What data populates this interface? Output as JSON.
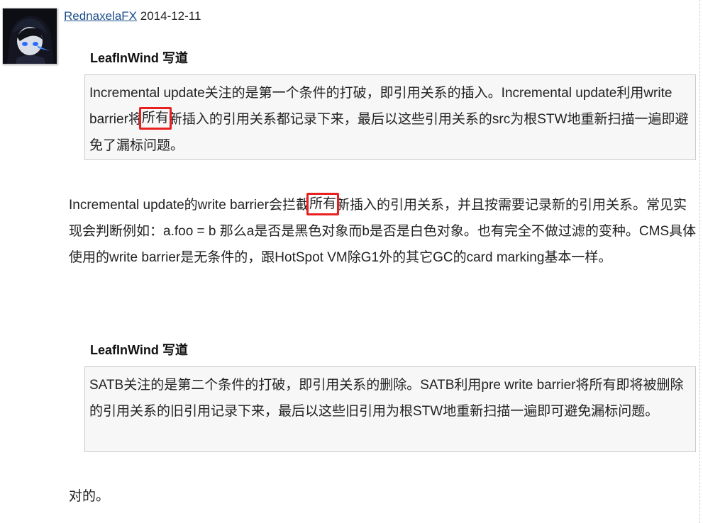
{
  "comment": {
    "author": "RednaxelaFX",
    "date": "2014-12-11"
  },
  "quote1": {
    "title": "LeafInWind 写道",
    "before": "Incremental update关注的是第一个条件的打破，即引用关系的插入。Incremental update利用write barrier将",
    "highlight": "所有",
    "after": "新插入的引用关系都记录下来，最后以这些引用关系的src为根STW地重新扫描一遍即避免了漏标问题。"
  },
  "reply1": {
    "before": "Incremental update的write barrier会拦截",
    "highlight": "所有",
    "after": "新插入的引用关系，并且按需要记录新的引用关系。常见实现会判断例如：a.foo = b 那么a是否是黑色对象而b是否是白色对象。也有完全不做过滤的变种。CMS具体使用的write barrier是无条件的，跟HotSpot VM除G1外的其它GC的card marking基本一样。"
  },
  "quote2": {
    "title": "LeafInWind 写道",
    "text": "SATB关注的是第二个条件的打破，即引用关系的删除。SATB利用pre write barrier将所有即将被删除的引用关系的旧引用记录下来，最后以这些旧引用为根STW地重新扫描一遍即可避免漏标问题。"
  },
  "reply2": {
    "text": "对的。"
  },
  "colors": {
    "link": "#1c4f8c",
    "highlight_border": "#e8201f",
    "quote_background": "#f7f7f7"
  }
}
